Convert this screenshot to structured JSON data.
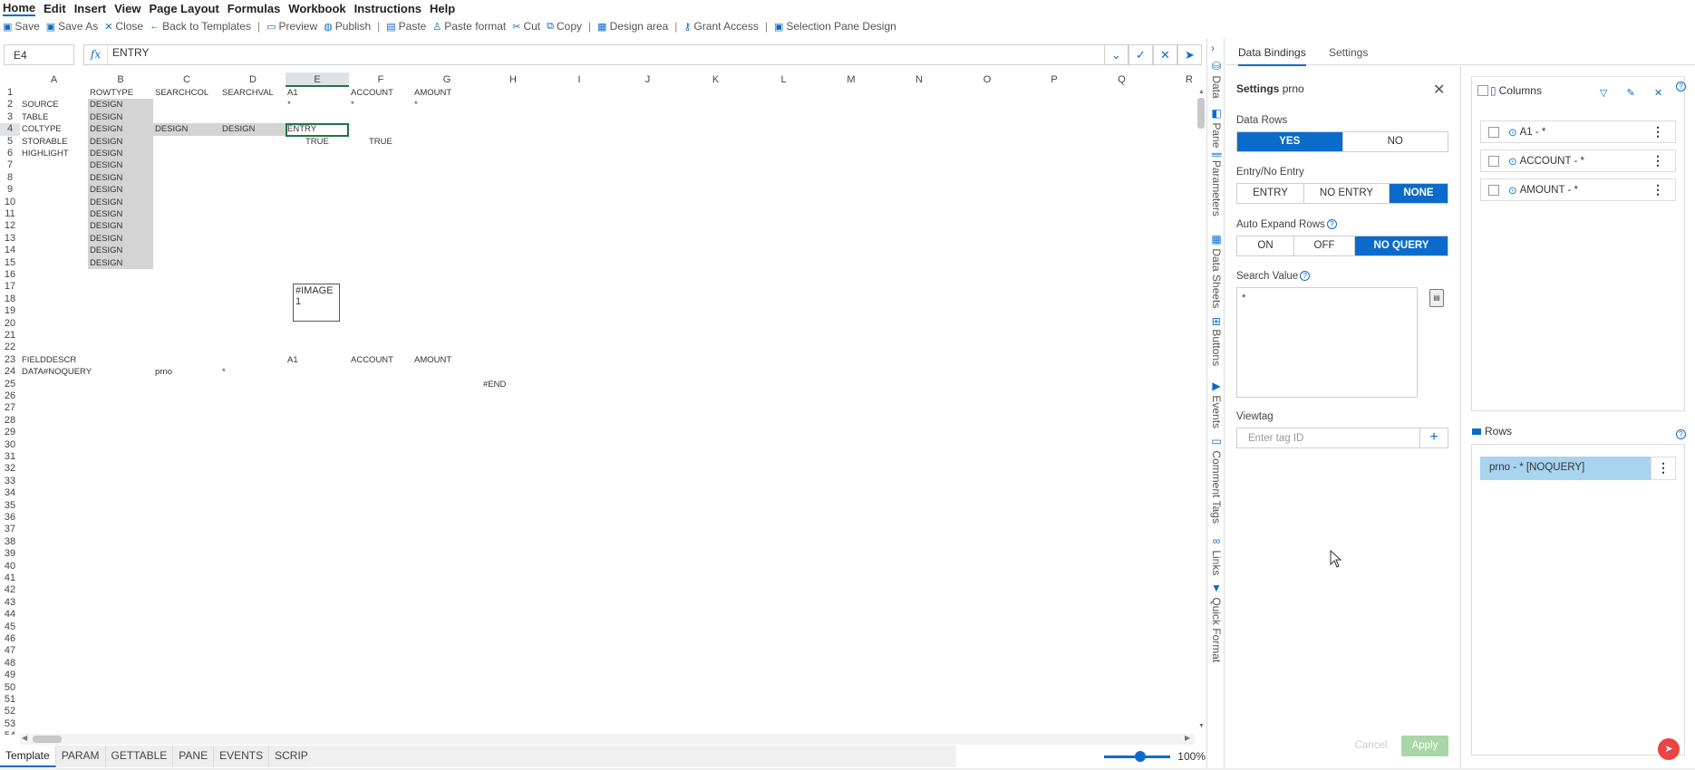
{
  "menu": [
    "Home",
    "Edit",
    "Insert",
    "View",
    "Page Layout",
    "Formulas",
    "Workbook",
    "Instructions",
    "Help"
  ],
  "toolbar": {
    "save": "Save",
    "save_as": "Save As",
    "close": "Close",
    "back": "Back to Templates",
    "preview": "Preview",
    "publish": "Publish",
    "paste": "Paste",
    "paste_format": "Paste format",
    "cut": "Cut",
    "copy": "Copy",
    "design_area": "Design area",
    "grant_access": "Grant Access",
    "selection_pane": "Selection Pane Design",
    "sep": "|"
  },
  "formula_bar": {
    "name_box": "E4",
    "fx": "fx",
    "value": "ENTRY"
  },
  "grid": {
    "columns": [
      "A",
      "B",
      "C",
      "D",
      "E",
      "F",
      "G",
      "H",
      "I",
      "J",
      "K",
      "L",
      "M",
      "N",
      "O",
      "P",
      "Q",
      "R"
    ],
    "selected_column": "E",
    "selected_row": "4",
    "cells": {
      "B1": "ROWTYPE",
      "C1": "SEARCHCOL",
      "D1": "SEARCHVAL",
      "E1": "A1",
      "F1": "ACCOUNT",
      "G1": "AMOUNT",
      "A2": "SOURCE",
      "B2": "DESIGN",
      "E2": "*",
      "F2": "*",
      "G2": "*",
      "A3": "TABLE",
      "B3": "DESIGN",
      "A4": "COLTYPE",
      "B4": "DESIGN",
      "C4": "DESIGN",
      "D4": "DESIGN",
      "E4": "ENTRY",
      "A5": "STORABLE",
      "B5": "DESIGN",
      "E5": "TRUE",
      "F5": "TRUE",
      "A6": "HIGHLIGHT",
      "B6": "DESIGN",
      "B7": "DESIGN",
      "B8": "DESIGN",
      "B9": "DESIGN",
      "B10": "DESIGN",
      "B11": "DESIGN",
      "B12": "DESIGN",
      "B13": "DESIGN",
      "B14": "DESIGN",
      "B15": "DESIGN",
      "A23": "FIELDDESCR",
      "E23": "A1",
      "F23": "ACCOUNT",
      "G23": "AMOUNT",
      "A24": "DATA#NOQUERY",
      "C24": "prno",
      "D24": "*",
      "H25": "#END"
    },
    "image_label": "#IMAGE 1"
  },
  "sheet_tabs": [
    "Template",
    "PARAM",
    "GETTABLE",
    "PANE",
    "EVENTS",
    "SCRIPTS"
  ],
  "active_sheet": "Template",
  "zoom": {
    "label": "100%",
    "value": 1.0
  },
  "side_tabs": [
    "Data",
    "Pane",
    "Parameters",
    "Data Sheets",
    "Buttons",
    "Events",
    "Comment Tags",
    "Links",
    "Quick Format"
  ],
  "settings_panel": {
    "tabs": [
      "Data Bindings",
      "Settings"
    ],
    "active_tab": "Data Bindings",
    "title": "Settings",
    "title_name": "prno",
    "data_rows": {
      "label": "Data Rows",
      "options": [
        "YES",
        "NO"
      ],
      "selected": "YES"
    },
    "entry": {
      "label": "Entry/No Entry",
      "options": [
        "ENTRY",
        "NO ENTRY",
        "NONE"
      ],
      "selected": "NONE"
    },
    "auto_expand": {
      "label": "Auto Expand Rows",
      "options": [
        "ON",
        "OFF",
        "NO QUERY"
      ],
      "selected": "NO QUERY"
    },
    "search_value": {
      "label": "Search Value",
      "value": "*"
    },
    "viewtag": {
      "label": "Viewtag",
      "placeholder": "Enter tag ID"
    },
    "cancel": "Cancel",
    "apply": "Apply"
  },
  "columns_panel": {
    "title": "Columns",
    "items": [
      "A1 - *",
      "ACCOUNT - *",
      "AMOUNT - *"
    ]
  },
  "rows_panel": {
    "title": "Rows",
    "items": [
      "prno - * [NOQUERY]"
    ]
  },
  "colors": {
    "accent": "#0b6bcb",
    "selection": "#217346",
    "design_fill": "#d4d4d4",
    "row_highlight": "#a8d4f0",
    "apply_bg": "#a8d6a8"
  }
}
